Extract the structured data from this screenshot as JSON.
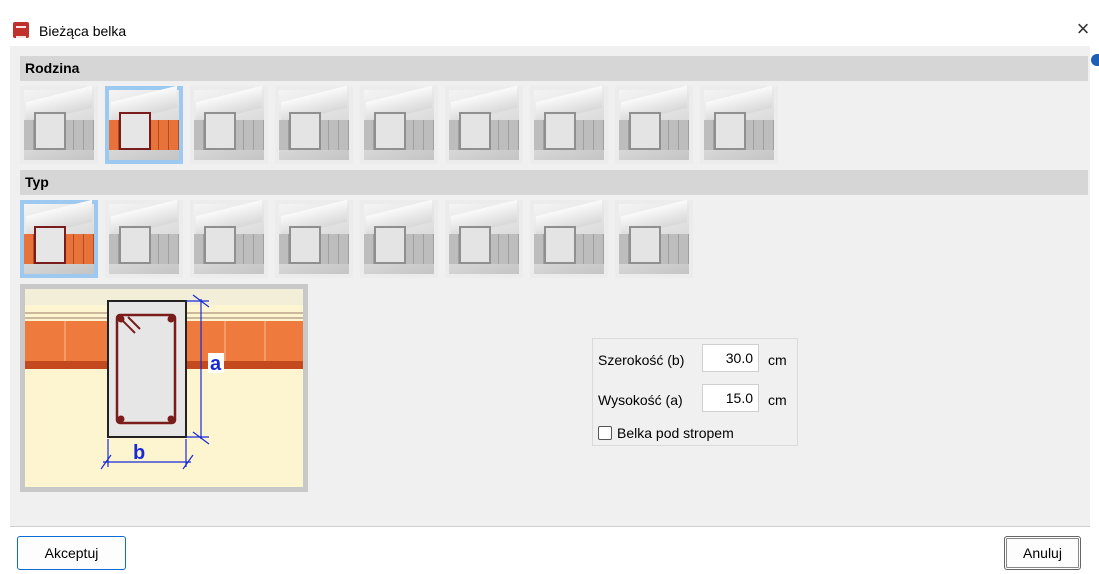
{
  "window": {
    "title": "Bieżąca belka",
    "close_glyph": "×"
  },
  "sections": {
    "family_title": "Rodzina",
    "type_title": "Typ"
  },
  "family_items": [
    {
      "id": "family-1",
      "selected": false
    },
    {
      "id": "family-2",
      "selected": true
    },
    {
      "id": "family-3",
      "selected": false
    },
    {
      "id": "family-4",
      "selected": false
    },
    {
      "id": "family-5",
      "selected": false
    },
    {
      "id": "family-6",
      "selected": false
    },
    {
      "id": "family-7",
      "selected": false
    },
    {
      "id": "family-8",
      "selected": false
    },
    {
      "id": "family-9",
      "selected": false
    }
  ],
  "type_items": [
    {
      "id": "type-1",
      "selected": true
    },
    {
      "id": "type-2",
      "selected": false
    },
    {
      "id": "type-3",
      "selected": false
    },
    {
      "id": "type-4",
      "selected": false
    },
    {
      "id": "type-5",
      "selected": false
    },
    {
      "id": "type-6",
      "selected": false
    },
    {
      "id": "type-7",
      "selected": false
    },
    {
      "id": "type-8",
      "selected": false
    }
  ],
  "preview": {
    "label_a": "a",
    "label_b": "b"
  },
  "params": {
    "width_label": "Szerokość (b)",
    "width_value": "30.0",
    "width_unit": "cm",
    "height_label": "Wysokość (a)",
    "height_value": "15.0",
    "height_unit": "cm",
    "under_slab_label": "Belka pod stropem",
    "under_slab_checked": false
  },
  "buttons": {
    "accept": "Akceptuj",
    "cancel": "Anuluj"
  },
  "colors": {
    "selection": "#9dc9f0",
    "brick": "#e8733a",
    "rebar": "#7a1c1c",
    "dimension": "#1a2bd6"
  }
}
